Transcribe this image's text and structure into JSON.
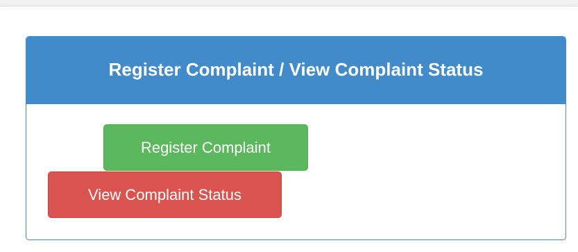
{
  "panel": {
    "title": "Register Complaint / View Complaint Status",
    "register_label": "Register Complaint",
    "view_label": "View Complaint Status"
  },
  "colors": {
    "primary": "#428bca",
    "success": "#5cb85c",
    "danger": "#d9534f"
  }
}
